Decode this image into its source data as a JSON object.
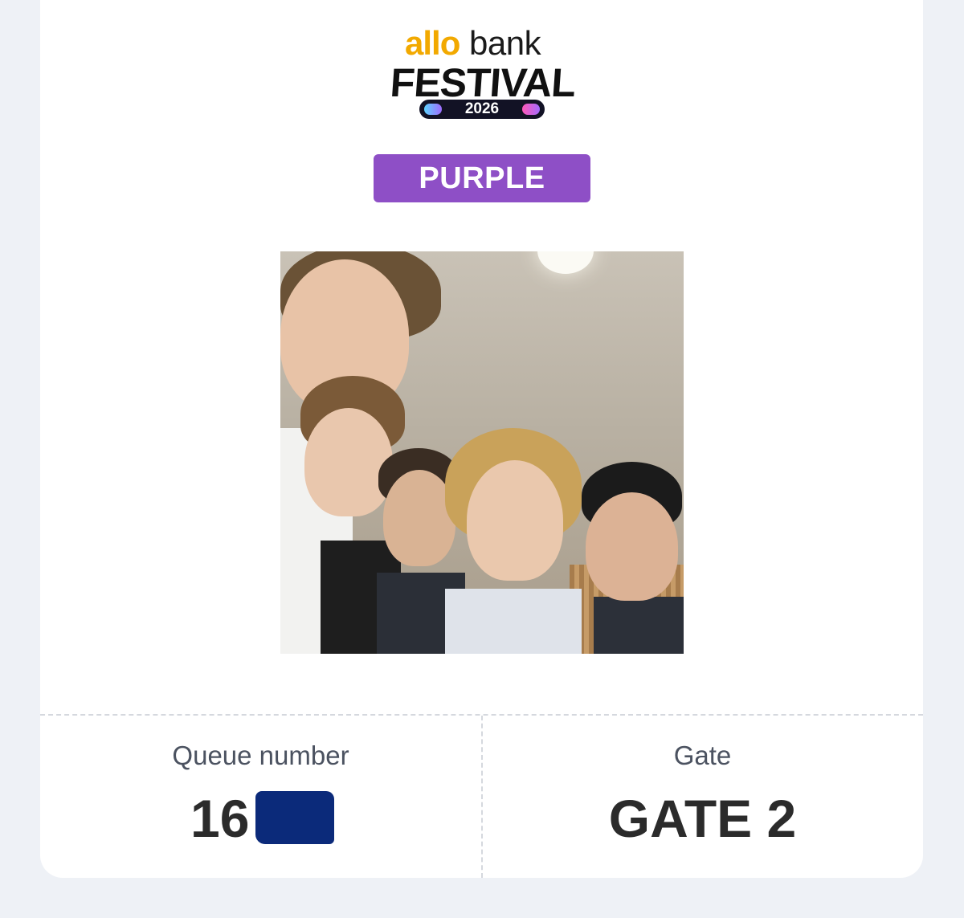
{
  "logo": {
    "brand_part1": "allo",
    "brand_part2": "bank",
    "event": "FESTIVAL",
    "year": "2026"
  },
  "ticket": {
    "category": "PURPLE",
    "category_color": "#8e4fc6",
    "queue_label": "Queue number",
    "queue_value": "16",
    "gate_label": "Gate",
    "gate_value": "GATE 2"
  }
}
